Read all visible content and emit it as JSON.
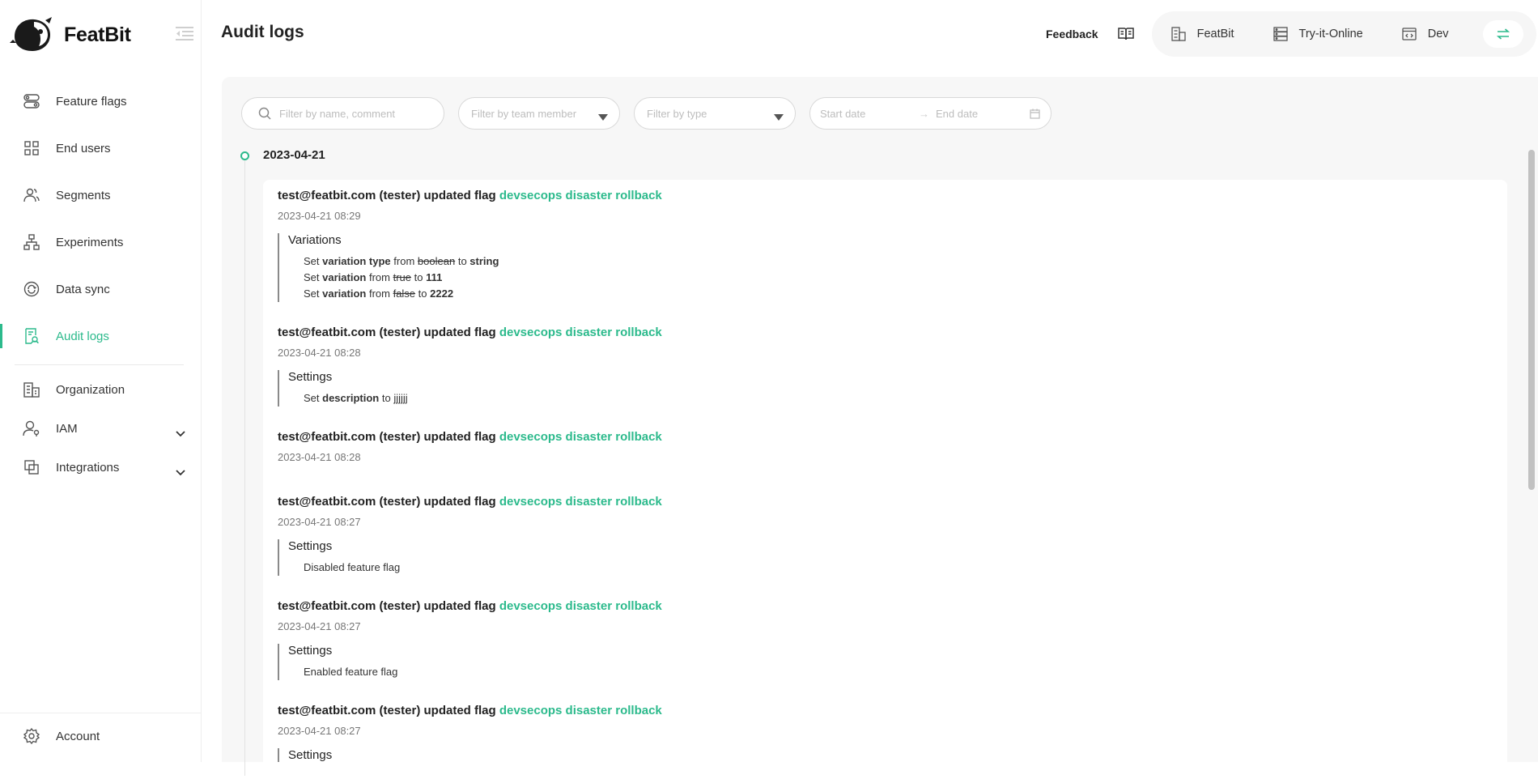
{
  "app": {
    "name": "FeatBit"
  },
  "sidebar": {
    "items": [
      {
        "label": "Feature flags",
        "icon": "toggle-icon"
      },
      {
        "label": "End users",
        "icon": "grid-icon"
      },
      {
        "label": "Segments",
        "icon": "users-icon"
      },
      {
        "label": "Experiments",
        "icon": "hierarchy-icon"
      },
      {
        "label": "Data sync",
        "icon": "sync-icon"
      },
      {
        "label": "Audit logs",
        "icon": "audit-icon"
      }
    ],
    "lower": [
      {
        "label": "Organization",
        "icon": "building-icon"
      },
      {
        "label": "IAM",
        "icon": "user-key-icon"
      },
      {
        "label": "Integrations",
        "icon": "integrations-icon"
      }
    ],
    "account": "Account",
    "accent": "#2cba8c"
  },
  "header": {
    "title": "Audit logs",
    "feedback": "Feedback",
    "env": {
      "organization": "FeatBit",
      "project": "Try-it-Online",
      "environment": "Dev"
    }
  },
  "filters": {
    "search_placeholder": "Filter by name, comment",
    "member_placeholder": "Filter by team member",
    "type_placeholder": "Filter by type",
    "start_placeholder": "Start date",
    "end_placeholder": "End date"
  },
  "timeline": {
    "date": "2023-04-21",
    "entries": [
      {
        "actor": "test@featbit.com (tester) updated flag",
        "flag": "devsecops disaster rollback",
        "time": "2023-04-21 08:29",
        "section": "Variations",
        "lines": [
          {
            "verb": "Set",
            "field": "variation type",
            "from_word": "from",
            "old": "boolean",
            "to_word": "to",
            "new": "string"
          },
          {
            "verb": "Set",
            "field": "variation",
            "from_word": "from",
            "old": "true",
            "to_word": "to",
            "new": "111"
          },
          {
            "verb": "Set",
            "field": "variation",
            "from_word": "from",
            "old": "false",
            "to_word": "to",
            "new": "2222"
          }
        ]
      },
      {
        "actor": "test@featbit.com (tester) updated flag",
        "flag": "devsecops disaster rollback",
        "time": "2023-04-21 08:28",
        "section": "Settings",
        "line": {
          "verb": "Set",
          "field": "description",
          "to_word": "to",
          "new": "jjjjjj"
        }
      },
      {
        "actor": "test@featbit.com (tester) updated flag",
        "flag": "devsecops disaster rollback",
        "time": "2023-04-21 08:28"
      },
      {
        "actor": "test@featbit.com (tester) updated flag",
        "flag": "devsecops disaster rollback",
        "time": "2023-04-21 08:27",
        "section": "Settings",
        "text": "Disabled feature flag"
      },
      {
        "actor": "test@featbit.com (tester) updated flag",
        "flag": "devsecops disaster rollback",
        "time": "2023-04-21 08:27",
        "section": "Settings",
        "text": "Enabled feature flag"
      },
      {
        "actor": "test@featbit.com (tester) updated flag",
        "flag": "devsecops disaster rollback",
        "time": "2023-04-21 08:27",
        "section": "Settings"
      }
    ]
  }
}
